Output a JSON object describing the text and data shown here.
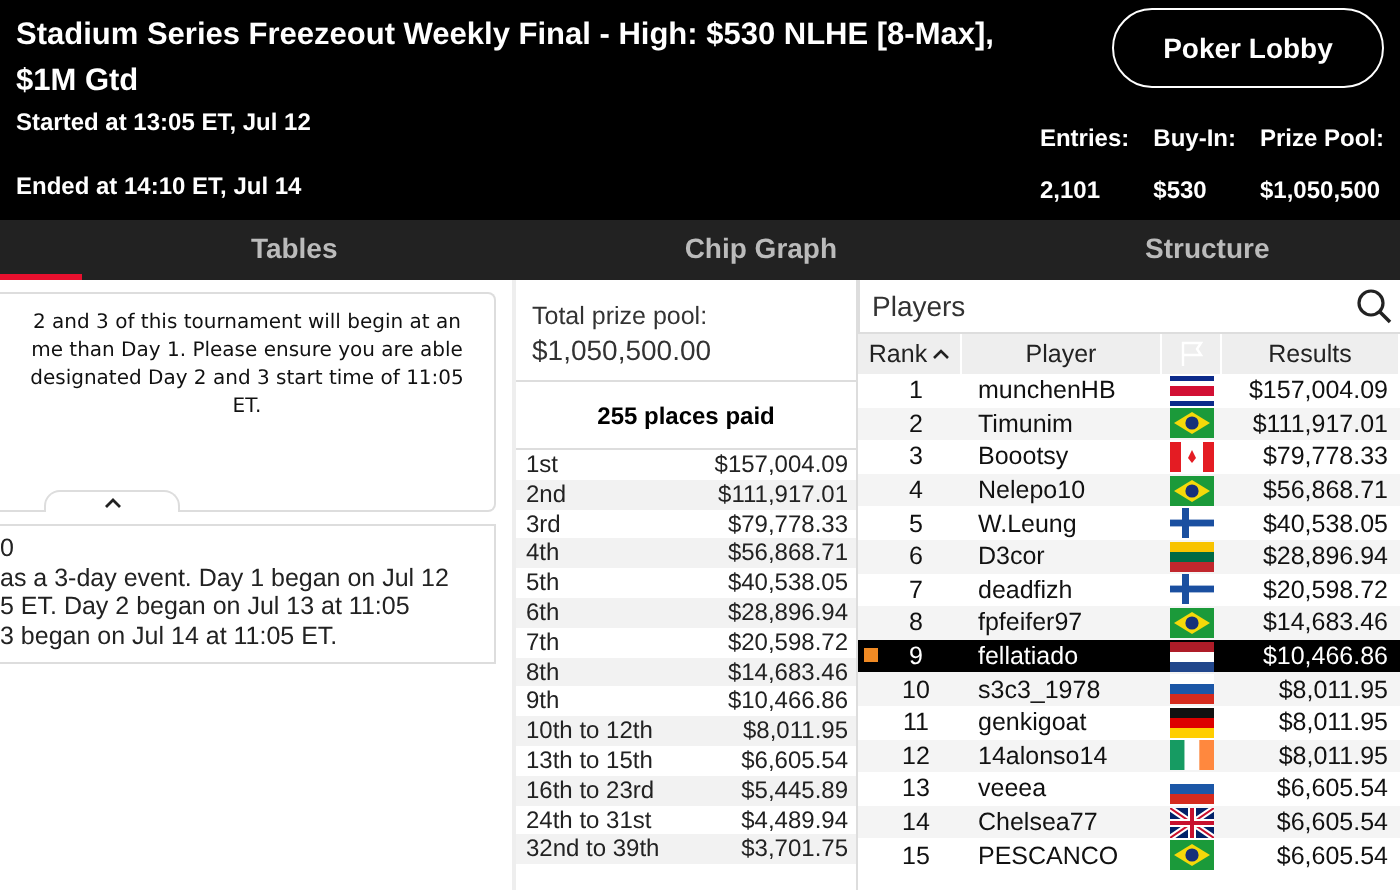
{
  "header": {
    "title": "Stadium Series Freezeout Weekly Final - High: $530 NLHE [8-Max], $1M Gtd",
    "started": "Started at 13:05 ET, Jul 12",
    "ended": "Ended at 14:10 ET, Jul 14",
    "lobby_button": "Poker Lobby",
    "stats": [
      {
        "label": "Entries:",
        "value": "2,101"
      },
      {
        "label": "Buy-In:",
        "value": "$530"
      },
      {
        "label": "Prize Pool:",
        "value": "$1,050,500"
      }
    ]
  },
  "tabs": [
    {
      "selected": true
    },
    {
      "label": "Tables",
      "selected": false
    },
    {
      "label": "Chip Graph",
      "selected": false
    },
    {
      "label": "Structure",
      "selected": false
    }
  ],
  "notice": {
    "lines": [
      "2 and 3 of this tournament will begin at an",
      "me than Day 1. Please ensure you are able",
      "designated Day 2 and 3 start time of 11:05",
      "ET."
    ]
  },
  "info": {
    "lines": [
      "0",
      "as a 3-day event. Day 1 began on Jul 12",
      "5 ET. Day 2 began on Jul 13 at 11:05",
      "3 began on Jul 14 at 11:05 ET."
    ]
  },
  "prizes": {
    "total_label": "Total prize pool:",
    "total": "$1,050,500.00",
    "places": "255 places paid",
    "rows": [
      {
        "place": "1st",
        "amount": "$157,004.09"
      },
      {
        "place": "2nd",
        "amount": "$111,917.01"
      },
      {
        "place": "3rd",
        "amount": "$79,778.33"
      },
      {
        "place": "4th",
        "amount": "$56,868.71"
      },
      {
        "place": "5th",
        "amount": "$40,538.05"
      },
      {
        "place": "6th",
        "amount": "$28,896.94"
      },
      {
        "place": "7th",
        "amount": "$20,598.72"
      },
      {
        "place": "8th",
        "amount": "$14,683.46"
      },
      {
        "place": "9th",
        "amount": "$10,466.86"
      },
      {
        "place": "10th to 12th",
        "amount": "$8,011.95"
      },
      {
        "place": "13th to 15th",
        "amount": "$6,605.54"
      },
      {
        "place": "16th to 23rd",
        "amount": "$5,445.89"
      },
      {
        "place": "24th to 31st",
        "amount": "$4,489.94"
      },
      {
        "place": "32nd to 39th",
        "amount": "$3,701.75"
      }
    ]
  },
  "players": {
    "title": "Players",
    "columns": [
      "Rank",
      "Player",
      "Results"
    ],
    "rows": [
      {
        "rank": "1",
        "name": "munchenHB",
        "kind": "costarica",
        "result": "$157,004.09",
        "selected": false
      },
      {
        "rank": "2",
        "name": "Timunim",
        "kind": "brazil",
        "result": "$111,917.01",
        "selected": false
      },
      {
        "rank": "3",
        "name": "Boootsy",
        "kind": "canada",
        "result": "$79,778.33",
        "selected": false
      },
      {
        "rank": "4",
        "name": "Nelepo10",
        "kind": "brazil",
        "result": "$56,868.71",
        "selected": false
      },
      {
        "rank": "5",
        "name": "W.Leung",
        "kind": "finland",
        "result": "$40,538.05",
        "selected": false
      },
      {
        "rank": "6",
        "name": "D3cor",
        "kind": "lithuania",
        "result": "$28,896.94",
        "selected": false
      },
      {
        "rank": "7",
        "name": "deadfizh",
        "kind": "finland",
        "result": "$20,598.72",
        "selected": false
      },
      {
        "rank": "8",
        "name": "fpfeifer97",
        "kind": "brazil",
        "result": "$14,683.46",
        "selected": false
      },
      {
        "rank": "9",
        "name": "fellatiado",
        "kind": "netherlands",
        "result": "$10,466.86",
        "selected": true
      },
      {
        "rank": "10",
        "name": "s3c3_1978",
        "kind": "russia",
        "result": "$8,011.95",
        "selected": false
      },
      {
        "rank": "11",
        "name": "genkigoat",
        "kind": "germany",
        "result": "$8,011.95",
        "selected": false
      },
      {
        "rank": "12",
        "name": "14alonso14",
        "kind": "ireland",
        "result": "$8,011.95",
        "selected": false
      },
      {
        "rank": "13",
        "name": "veeea",
        "kind": "russia",
        "result": "$6,605.54",
        "selected": false
      },
      {
        "rank": "14",
        "name": "Chelsea77",
        "kind": "uk",
        "result": "$6,605.54",
        "selected": false
      },
      {
        "rank": "15",
        "name": "PESCANCO",
        "kind": "brazil",
        "result": "$6,605.54",
        "selected": false
      }
    ]
  }
}
